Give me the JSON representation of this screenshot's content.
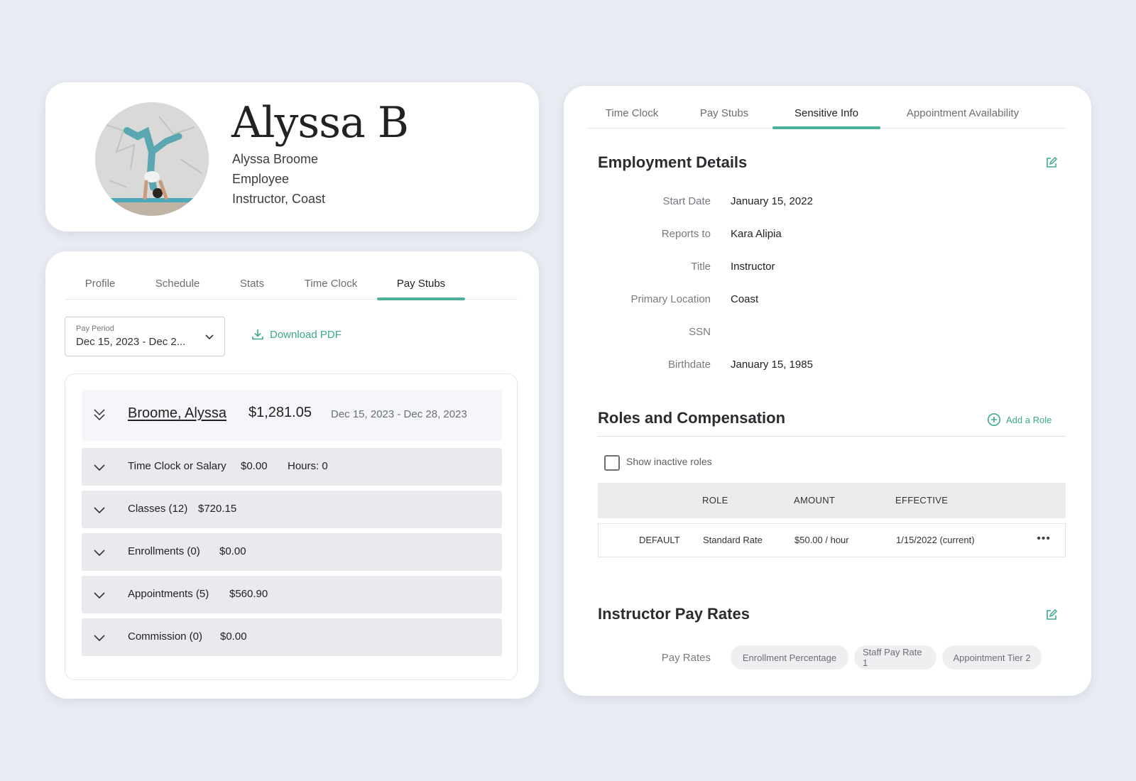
{
  "profile": {
    "display_name": "Alyssa B",
    "full_name": "Alyssa Broome",
    "employment_type": "Employee",
    "role_location": "Instructor, Coast"
  },
  "paystubs_panel": {
    "tabs": [
      {
        "label": "Profile"
      },
      {
        "label": "Schedule"
      },
      {
        "label": "Stats"
      },
      {
        "label": "Time Clock"
      },
      {
        "label": "Pay Stubs",
        "active": true
      }
    ],
    "pay_period": {
      "label": "Pay Period",
      "value": "Dec 15, 2023 - Dec 2..."
    },
    "download_label": "Download PDF",
    "stub": {
      "last_name": "Broome",
      "separator": ",",
      "first_name": "Alyssa",
      "total": "$1,281.05",
      "range": "Dec 15, 2023 - Dec 28, 2023",
      "rows": [
        {
          "label": "Time Clock or Salary",
          "amount": "$0.00",
          "extra": "Hours: 0"
        },
        {
          "label": "Classes (12)",
          "amount": "$720.15"
        },
        {
          "label": "Enrollments (0)",
          "amount": "$0.00"
        },
        {
          "label": "Appointments (5)",
          "amount": "$560.90"
        },
        {
          "label": "Commission (0)",
          "amount": "$0.00"
        }
      ]
    }
  },
  "details_panel": {
    "tabs": [
      {
        "label": "Time Clock"
      },
      {
        "label": "Pay Stubs"
      },
      {
        "label": "Sensitive Info",
        "active": true
      },
      {
        "label": "Appointment Availability"
      }
    ],
    "employment": {
      "title": "Employment Details",
      "fields": [
        {
          "label": "Start Date",
          "value": "January 15, 2022"
        },
        {
          "label": "Reports to",
          "value": "Kara Alipia"
        },
        {
          "label": "Title",
          "value": "Instructor"
        },
        {
          "label": "Primary Location",
          "value": "Coast"
        },
        {
          "label": "SSN",
          "value": ""
        },
        {
          "label": "Birthdate",
          "value": "January 15, 1985"
        }
      ]
    },
    "roles": {
      "title": "Roles and Compensation",
      "add_label": "Add a Role",
      "show_inactive_label": "Show inactive roles",
      "show_inactive_checked": false,
      "columns": [
        "ROLE",
        "AMOUNT",
        "EFFECTIVE"
      ],
      "rows": [
        {
          "tag": "DEFAULT",
          "role": "Standard Rate",
          "amount": "$50.00 / hour",
          "effective": "1/15/2022 (current)"
        }
      ],
      "more_label": "•••"
    },
    "pay_rates": {
      "title": "Instructor Pay Rates",
      "label": "Pay Rates",
      "pills": [
        "Enrollment Percentage",
        "Staff Pay Rate 1",
        "Appointment Tier 2"
      ]
    }
  },
  "colors": {
    "accent": "#4cb09a",
    "background": "#e9ecf3",
    "row_bg": "#e9eaee"
  }
}
